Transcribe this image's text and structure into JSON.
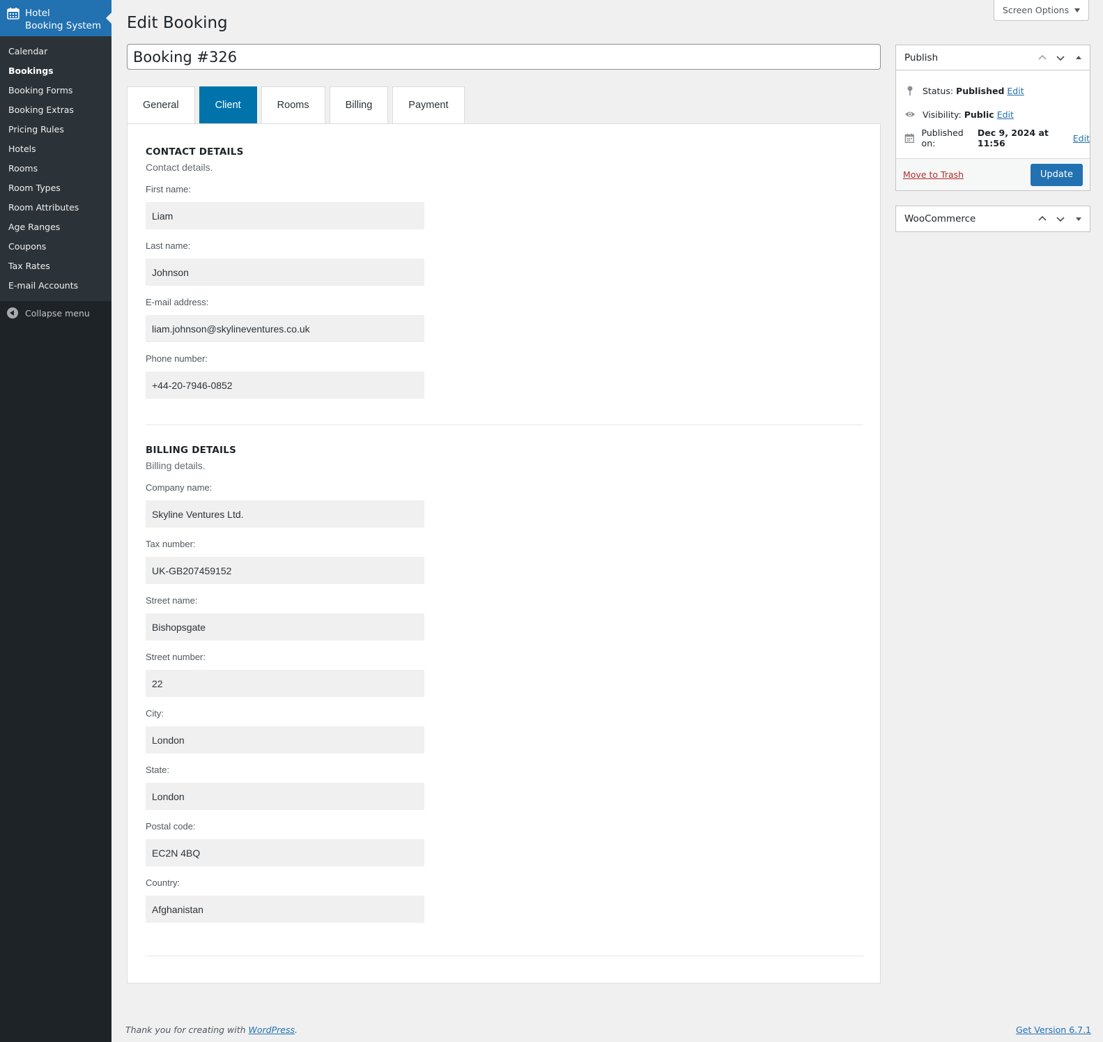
{
  "sidebar": {
    "brand_line1": "Hotel",
    "brand_line2": "Booking System",
    "items": [
      {
        "label": "Calendar"
      },
      {
        "label": "Bookings"
      },
      {
        "label": "Booking Forms"
      },
      {
        "label": "Booking Extras"
      },
      {
        "label": "Pricing Rules"
      },
      {
        "label": "Hotels"
      },
      {
        "label": "Rooms"
      },
      {
        "label": "Room Types"
      },
      {
        "label": "Room Attributes"
      },
      {
        "label": "Age Ranges"
      },
      {
        "label": "Coupons"
      },
      {
        "label": "Tax Rates"
      },
      {
        "label": "E-mail Accounts"
      }
    ],
    "collapse_label": "Collapse menu"
  },
  "header": {
    "screen_options": "Screen Options",
    "page_title": "Edit Booking",
    "post_title": "Booking #326"
  },
  "tabs": [
    {
      "label": "General"
    },
    {
      "label": "Client"
    },
    {
      "label": "Rooms"
    },
    {
      "label": "Billing"
    },
    {
      "label": "Payment"
    }
  ],
  "contact": {
    "title": "CONTACT DETAILS",
    "desc": "Contact details.",
    "fields": [
      {
        "label": "First name:",
        "value": "Liam"
      },
      {
        "label": "Last name:",
        "value": "Johnson"
      },
      {
        "label": "E-mail address:",
        "value": "liam.johnson@skylineventures.co.uk"
      },
      {
        "label": "Phone number:",
        "value": "+44-20-7946-0852"
      }
    ]
  },
  "billing": {
    "title": "BILLING DETAILS",
    "desc": "Billing details.",
    "fields": [
      {
        "label": "Company name:",
        "value": "Skyline Ventures Ltd."
      },
      {
        "label": "Tax number:",
        "value": "UK-GB207459152"
      },
      {
        "label": "Street name:",
        "value": "Bishopsgate"
      },
      {
        "label": "Street number:",
        "value": "22"
      },
      {
        "label": "City:",
        "value": "London"
      },
      {
        "label": "State:",
        "value": "London"
      },
      {
        "label": "Postal code:",
        "value": "EC2N 4BQ"
      },
      {
        "label": "Country:",
        "value": "Afghanistan"
      }
    ]
  },
  "publish": {
    "title": "Publish",
    "status_label": "Status:",
    "status_value": "Published",
    "visibility_label": "Visibility:",
    "visibility_value": "Public",
    "published_label": "Published on:",
    "published_value": "Dec 9, 2024 at 11:56",
    "edit_label": "Edit",
    "trash_label": "Move to Trash",
    "update_label": "Update"
  },
  "woocommerce": {
    "title": "WooCommerce"
  },
  "footer": {
    "thanks_prefix": "Thank you for creating with ",
    "thanks_link": "WordPress",
    "thanks_suffix": ".",
    "version": "Get Version 6.7.1"
  },
  "colors": {
    "accent": "#2271b1",
    "tab_active": "#0073aa",
    "sidebar_bg": "#1d2327",
    "danger": "#b32d2e"
  }
}
